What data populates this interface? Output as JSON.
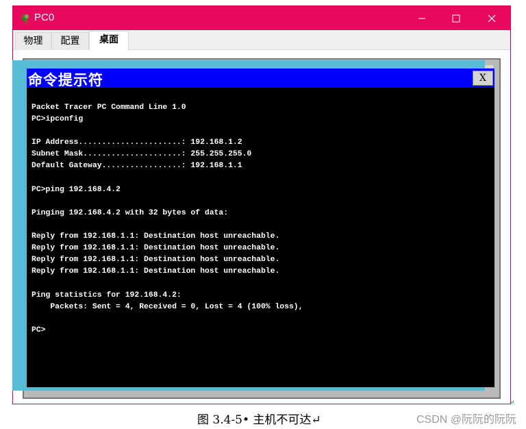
{
  "window": {
    "title": "PC0",
    "icon": "network-pc-icon",
    "minimize_glyph": "—",
    "maximize_glyph": "☐",
    "close_glyph": "✕"
  },
  "tabs": [
    {
      "label": "物理"
    },
    {
      "label": "配置"
    },
    {
      "label": "桌面",
      "active": true
    }
  ],
  "cmd": {
    "title": "命令提示符",
    "close_label": "X",
    "lines": [
      "Packet Tracer PC Command Line 1.0",
      "PC>ipconfig",
      "",
      "IP Address......................: 192.168.1.2",
      "Subnet Mask.....................: 255.255.255.0",
      "Default Gateway.................: 192.168.1.1",
      "",
      "PC>ping 192.168.4.2",
      "",
      "Pinging 192.168.4.2 with 32 bytes of data:",
      "",
      "Reply from 192.168.1.1: Destination host unreachable.",
      "Reply from 192.168.1.1: Destination host unreachable.",
      "Reply from 192.168.1.1: Destination host unreachable.",
      "Reply from 192.168.1.1: Destination host unreachable.",
      "",
      "Ping statistics for 192.168.4.2:",
      "    Packets: Sent = 4, Received = 0, Lost = 4 (100% loss),",
      "",
      "PC>"
    ]
  },
  "caption": "图 3.4-5• 主机不可达↵",
  "watermark": "CSDN @阮阮的阮阮",
  "colors": {
    "titlebar": "#e8085e",
    "cmd_titlebar": "#0000ff",
    "cmd_background": "#000000",
    "desktop_frame": "#56bcd6"
  }
}
